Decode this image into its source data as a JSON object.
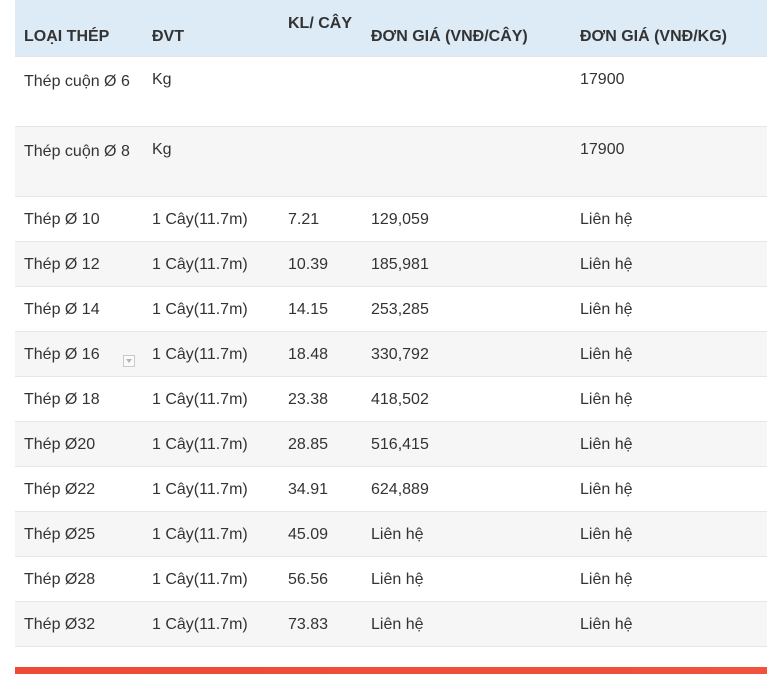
{
  "table": {
    "headers": {
      "type": "LOẠI THÉP",
      "unit": "ĐVT",
      "weight": "KL/ CÂY",
      "price_per_bar": "ĐƠN GIÁ (VNĐ/CÂY)",
      "price_per_kg": "ĐƠN GIÁ (VNĐ/KG)"
    },
    "rows": [
      {
        "type": "Thép cuộn Ø 6",
        "unit": "Kg",
        "weight": "",
        "price_per_bar": "",
        "price_per_kg": "17900"
      },
      {
        "type": "Thép cuộn Ø 8",
        "unit": "Kg",
        "weight": "",
        "price_per_bar": "",
        "price_per_kg": "17900"
      },
      {
        "type": "Thép Ø 10",
        "unit": "1 Cây(11.7m)",
        "weight": "7.21",
        "price_per_bar": "129,059",
        "price_per_kg": "Liên hệ"
      },
      {
        "type": "Thép Ø 12",
        "unit": "1 Cây(11.7m)",
        "weight": "10.39",
        "price_per_bar": "185,981",
        "price_per_kg": "Liên hệ"
      },
      {
        "type": "Thép Ø 14",
        "unit": "1 Cây(11.7m)",
        "weight": "14.15",
        "price_per_bar": "253,285",
        "price_per_kg": "Liên hệ"
      },
      {
        "type": "Thép Ø 16",
        "unit": "1 Cây(11.7m)",
        "weight": "18.48",
        "price_per_bar": "330,792",
        "price_per_kg": "Liên hệ"
      },
      {
        "type": "Thép Ø 18",
        "unit": "1 Cây(11.7m)",
        "weight": "23.38",
        "price_per_bar": "418,502",
        "price_per_kg": "Liên hệ"
      },
      {
        "type": "Thép Ø20",
        "unit": "1 Cây(11.7m)",
        "weight": "28.85",
        "price_per_bar": "516,415",
        "price_per_kg": "Liên hệ"
      },
      {
        "type": "Thép Ø22",
        "unit": "1 Cây(11.7m)",
        "weight": "34.91",
        "price_per_bar": "624,889",
        "price_per_kg": "Liên hệ"
      },
      {
        "type": "Thép Ø25",
        "unit": "1 Cây(11.7m)",
        "weight": "45.09",
        "price_per_bar": "Liên hệ",
        "price_per_kg": "Liên hệ"
      },
      {
        "type": "Thép Ø28",
        "unit": "1 Cây(11.7m)",
        "weight": "56.56",
        "price_per_bar": "Liên hệ",
        "price_per_kg": "Liên hệ"
      },
      {
        "type": "Thép Ø32",
        "unit": "1 Cây(11.7m)",
        "weight": "73.83",
        "price_per_bar": "Liên hệ",
        "price_per_kg": "Liên hệ"
      }
    ]
  },
  "icons": {
    "dropdown_marker": "chevron-down-icon"
  },
  "colors": {
    "header_bg": "#dcebf5",
    "accent_bar": "#ef4a36",
    "stripe": "#f6f6f6"
  }
}
